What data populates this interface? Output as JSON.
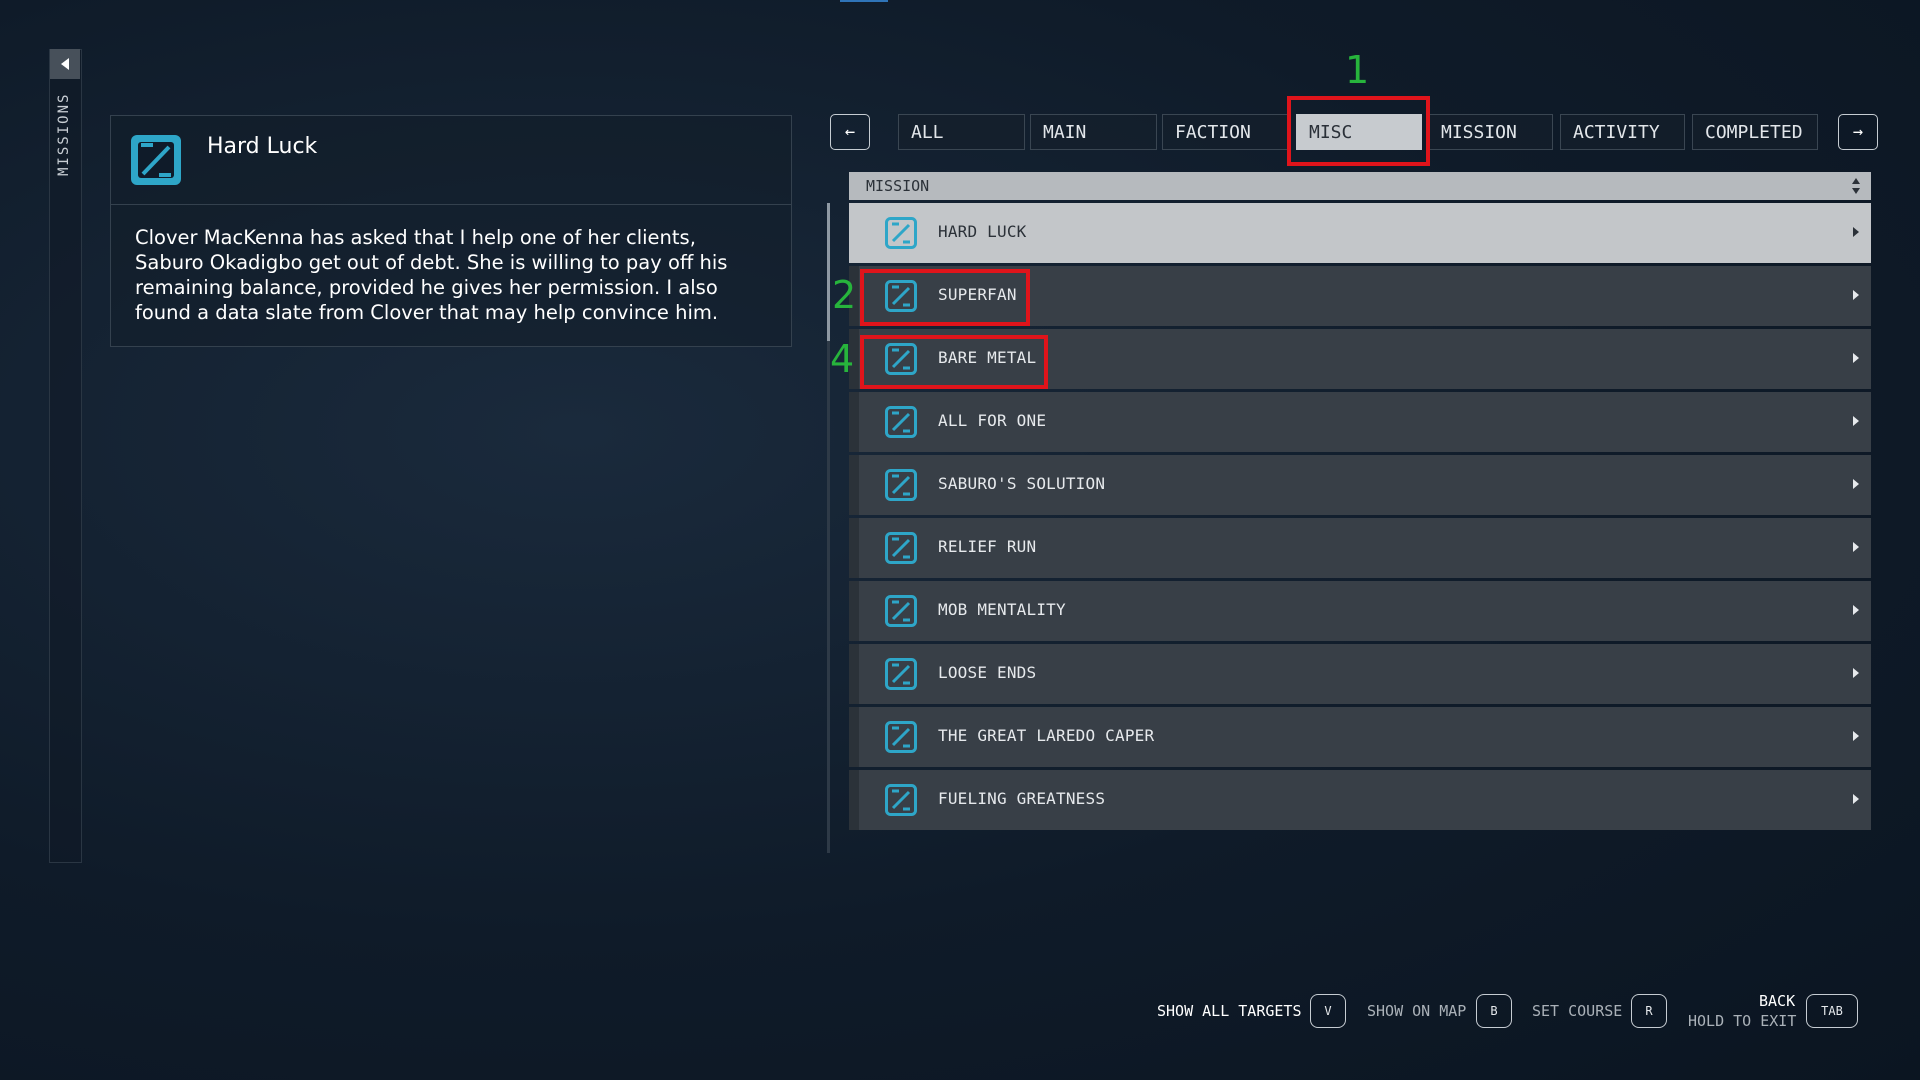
{
  "sidebar": {
    "label": "MISSIONS"
  },
  "detail": {
    "title": "Hard Luck",
    "description": "Clover MacKenna has asked that I help one of her clients, Saburo Okadigbo get out of debt. She is willing to pay off his remaining balance, provided he gives her permission. I also found a data slate from Clover that may help convince him."
  },
  "tabs": {
    "prev_arrow": "←",
    "next_arrow": "→",
    "items": [
      "ALL",
      "MAIN",
      "FACTION",
      "MISC",
      "MISSION",
      "ACTIVITY",
      "COMPLETED"
    ],
    "active": "MISC"
  },
  "list": {
    "header": "MISSION",
    "items": [
      "HARD LUCK",
      "SUPERFAN",
      "BARE METAL",
      "ALL FOR ONE",
      "SABURO'S SOLUTION",
      "RELIEF RUN",
      "MOB MENTALITY",
      "LOOSE ENDS",
      "THE GREAT LAREDO CAPER",
      "FUELING GREATNESS"
    ],
    "selected": "HARD LUCK"
  },
  "annotations": {
    "n1": "1",
    "n2": "2",
    "n4": "4"
  },
  "footer": {
    "show_all_targets": "SHOW ALL TARGETS",
    "key_v": "V",
    "show_on_map": "SHOW ON MAP",
    "key_b": "B",
    "set_course": "SET COURSE",
    "key_r": "R",
    "back": "BACK",
    "hold_to_exit": "HOLD TO EXIT",
    "key_tab": "TAB"
  },
  "colors": {
    "accent_icon": "#2ea6c8",
    "annotation_box": "#e0141b",
    "annotation_number": "#27b43c"
  }
}
